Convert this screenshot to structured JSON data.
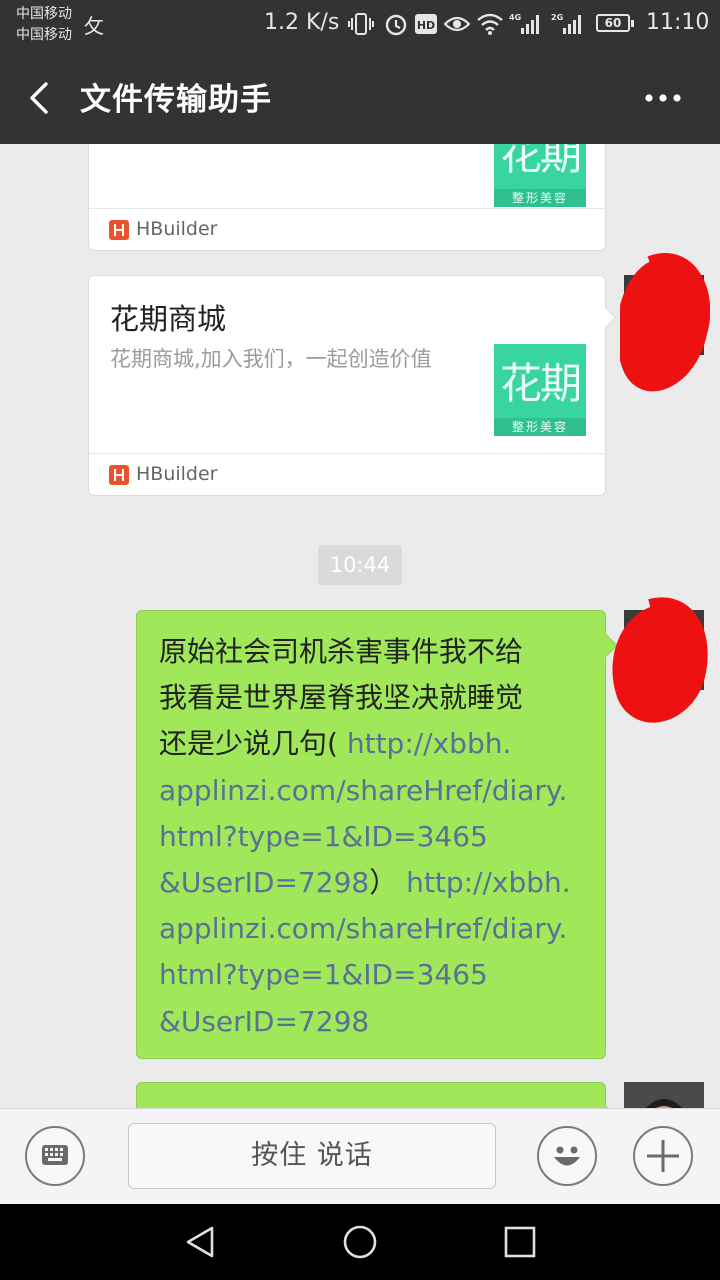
{
  "status_bar": {
    "carrier_1": "中国移动",
    "carrier_2": "中国移动",
    "carrier_glyph": "攵",
    "net_speed": "1.2 K/s",
    "signal_1_label": "4G",
    "signal_2_label": "2G",
    "battery": "60",
    "time": "11:10"
  },
  "header": {
    "title": "文件传输助手"
  },
  "messages": {
    "card_partial": {
      "source": "HBuilder",
      "thumb_big": "花期",
      "thumb_small": "整形美容"
    },
    "card_main": {
      "title": "花期商城",
      "description": "花期商城,加入我们，一起创造价值",
      "source": "HBuilder",
      "thumb_big": "花期",
      "thumb_small": "整形美容"
    },
    "timestamp": "10:44",
    "text_message": {
      "lines": [
        {
          "plain": "原始社会司机杀害事件我不给",
          "link": ""
        },
        {
          "plain": "我看是世界屋脊我坚决就睡觉",
          "link": ""
        },
        {
          "plain": "还是少说几句(",
          "link": " http://xbbh."
        },
        {
          "plain": "",
          "link": "applinzi.com/shareHref/diary."
        },
        {
          "plain": "",
          "link": "html?type=1&ID=3465"
        },
        {
          "plain": "",
          "link": "&UserID=7298",
          "after": "）",
          "link2": " http://xbbh."
        },
        {
          "plain": "",
          "link": "applinzi.com/shareHref/diary."
        },
        {
          "plain": "",
          "link": "html?type=1&ID=3465"
        },
        {
          "plain": "",
          "link": "&UserID=7298"
        }
      ]
    }
  },
  "input_bar": {
    "keyboard_icon": "keyboard-icon",
    "hold_to_talk": "按住 说话",
    "emoji_icon": "emoji-icon",
    "plus_icon": "plus-icon"
  },
  "colors": {
    "bar_bg": "#333333",
    "chat_bg": "#ebebeb",
    "bubble_green": "#a0e75a",
    "link_blue": "#5b7096",
    "thumb_green": "#39d59e"
  }
}
